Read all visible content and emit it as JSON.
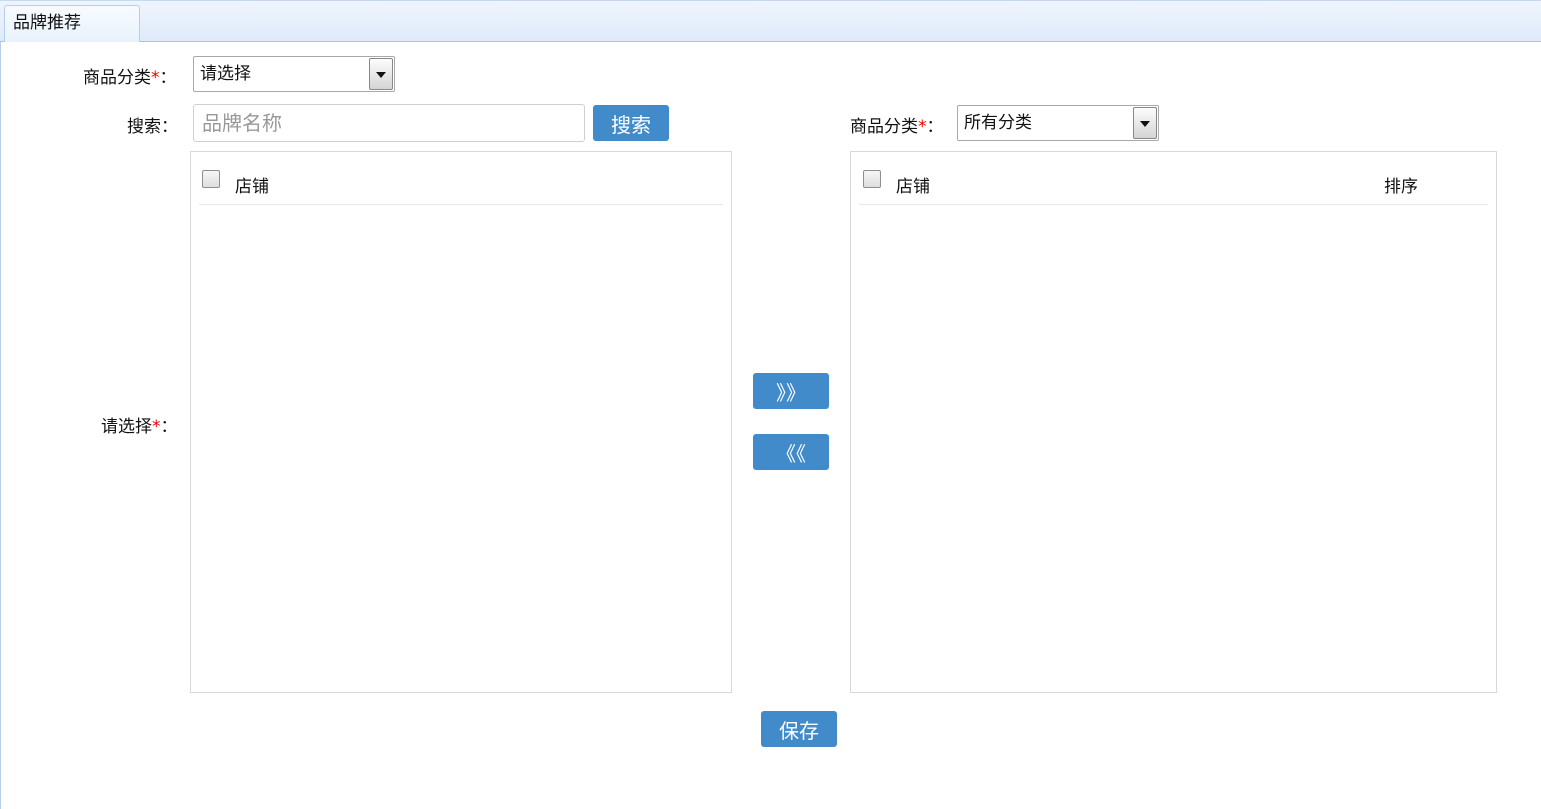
{
  "tab": {
    "title": "品牌推荐"
  },
  "form": {
    "category_label": "商品分类",
    "required_mark": "*",
    "colon": "：",
    "category_select_value": "请选择",
    "search_label": "搜索",
    "search_placeholder": "品牌名称",
    "search_button": "搜索",
    "select_label": "请选择"
  },
  "left_panel": {
    "columns": [
      "店铺"
    ]
  },
  "transfer": {
    "move_right": "》》",
    "move_left": "《《"
  },
  "right_panel": {
    "category_label": "商品分类",
    "category_select_value": "所有分类",
    "columns": [
      "店铺",
      "排序"
    ]
  },
  "save_button": "保存"
}
